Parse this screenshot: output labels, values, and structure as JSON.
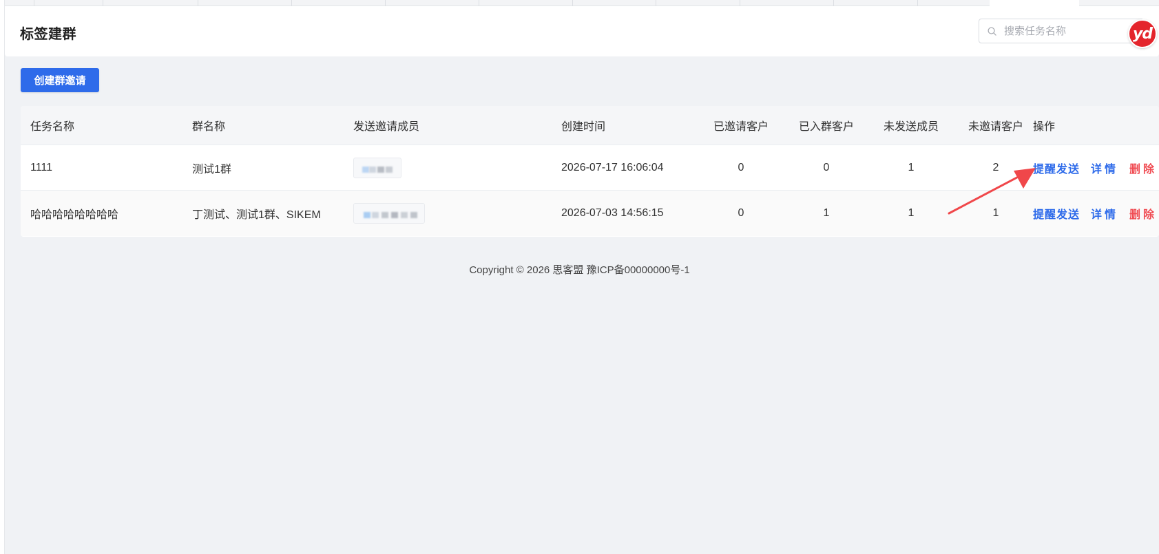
{
  "header": {
    "title": "标签建群",
    "search_placeholder": "搜索任务名称",
    "search_value": ""
  },
  "avatar": {
    "text": "yd",
    "color": "#e4252c"
  },
  "toolbar": {
    "create_label": "创建群邀请"
  },
  "table": {
    "columns": [
      "任务名称",
      "群名称",
      "发送邀请成员",
      "创建时间",
      "已邀请客户",
      "已入群客户",
      "未发送成员",
      "未邀请客户",
      "操作"
    ],
    "rows": [
      {
        "task_name": "1111",
        "group_name": "测试1群",
        "member": "(blurred)",
        "created": "2026-07-17 16:06:04",
        "invited": "0",
        "joined": "0",
        "unsent": "1",
        "uninvited": "2"
      },
      {
        "task_name": "哈哈哈哈哈哈哈哈",
        "group_name": "丁测试、测试1群、SIKEM",
        "member": "(blurred)",
        "created": "2026-07-03 14:56:15",
        "invited": "0",
        "joined": "1",
        "unsent": "1",
        "uninvited": "1"
      }
    ],
    "ops": {
      "remind": "提醒发送",
      "detail": "详情",
      "delete": "删除"
    }
  },
  "footer": {
    "copyright": "Copyright © 2026 思客盟 豫ICP备00000000号-1"
  },
  "colors": {
    "primary": "#2e6bea",
    "danger": "#f04b52",
    "arrow": "#f0474a",
    "background": "#f0f2f5"
  },
  "icons": {
    "search": "search-icon",
    "arrow": "red-arrow-annotation"
  }
}
